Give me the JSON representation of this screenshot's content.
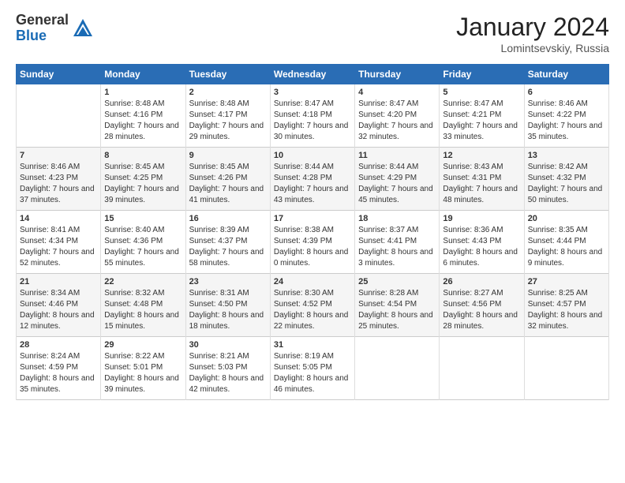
{
  "logo": {
    "general": "General",
    "blue": "Blue"
  },
  "title": "January 2024",
  "location": "Lomintsevskiy, Russia",
  "header_days": [
    "Sunday",
    "Monday",
    "Tuesday",
    "Wednesday",
    "Thursday",
    "Friday",
    "Saturday"
  ],
  "weeks": [
    [
      {
        "day": "",
        "sunrise": "",
        "sunset": "",
        "daylight": ""
      },
      {
        "day": "1",
        "sunrise": "Sunrise: 8:48 AM",
        "sunset": "Sunset: 4:16 PM",
        "daylight": "Daylight: 7 hours and 28 minutes."
      },
      {
        "day": "2",
        "sunrise": "Sunrise: 8:48 AM",
        "sunset": "Sunset: 4:17 PM",
        "daylight": "Daylight: 7 hours and 29 minutes."
      },
      {
        "day": "3",
        "sunrise": "Sunrise: 8:47 AM",
        "sunset": "Sunset: 4:18 PM",
        "daylight": "Daylight: 7 hours and 30 minutes."
      },
      {
        "day": "4",
        "sunrise": "Sunrise: 8:47 AM",
        "sunset": "Sunset: 4:20 PM",
        "daylight": "Daylight: 7 hours and 32 minutes."
      },
      {
        "day": "5",
        "sunrise": "Sunrise: 8:47 AM",
        "sunset": "Sunset: 4:21 PM",
        "daylight": "Daylight: 7 hours and 33 minutes."
      },
      {
        "day": "6",
        "sunrise": "Sunrise: 8:46 AM",
        "sunset": "Sunset: 4:22 PM",
        "daylight": "Daylight: 7 hours and 35 minutes."
      }
    ],
    [
      {
        "day": "7",
        "sunrise": "Sunrise: 8:46 AM",
        "sunset": "Sunset: 4:23 PM",
        "daylight": "Daylight: 7 hours and 37 minutes."
      },
      {
        "day": "8",
        "sunrise": "Sunrise: 8:45 AM",
        "sunset": "Sunset: 4:25 PM",
        "daylight": "Daylight: 7 hours and 39 minutes."
      },
      {
        "day": "9",
        "sunrise": "Sunrise: 8:45 AM",
        "sunset": "Sunset: 4:26 PM",
        "daylight": "Daylight: 7 hours and 41 minutes."
      },
      {
        "day": "10",
        "sunrise": "Sunrise: 8:44 AM",
        "sunset": "Sunset: 4:28 PM",
        "daylight": "Daylight: 7 hours and 43 minutes."
      },
      {
        "day": "11",
        "sunrise": "Sunrise: 8:44 AM",
        "sunset": "Sunset: 4:29 PM",
        "daylight": "Daylight: 7 hours and 45 minutes."
      },
      {
        "day": "12",
        "sunrise": "Sunrise: 8:43 AM",
        "sunset": "Sunset: 4:31 PM",
        "daylight": "Daylight: 7 hours and 48 minutes."
      },
      {
        "day": "13",
        "sunrise": "Sunrise: 8:42 AM",
        "sunset": "Sunset: 4:32 PM",
        "daylight": "Daylight: 7 hours and 50 minutes."
      }
    ],
    [
      {
        "day": "14",
        "sunrise": "Sunrise: 8:41 AM",
        "sunset": "Sunset: 4:34 PM",
        "daylight": "Daylight: 7 hours and 52 minutes."
      },
      {
        "day": "15",
        "sunrise": "Sunrise: 8:40 AM",
        "sunset": "Sunset: 4:36 PM",
        "daylight": "Daylight: 7 hours and 55 minutes."
      },
      {
        "day": "16",
        "sunrise": "Sunrise: 8:39 AM",
        "sunset": "Sunset: 4:37 PM",
        "daylight": "Daylight: 7 hours and 58 minutes."
      },
      {
        "day": "17",
        "sunrise": "Sunrise: 8:38 AM",
        "sunset": "Sunset: 4:39 PM",
        "daylight": "Daylight: 8 hours and 0 minutes."
      },
      {
        "day": "18",
        "sunrise": "Sunrise: 8:37 AM",
        "sunset": "Sunset: 4:41 PM",
        "daylight": "Daylight: 8 hours and 3 minutes."
      },
      {
        "day": "19",
        "sunrise": "Sunrise: 8:36 AM",
        "sunset": "Sunset: 4:43 PM",
        "daylight": "Daylight: 8 hours and 6 minutes."
      },
      {
        "day": "20",
        "sunrise": "Sunrise: 8:35 AM",
        "sunset": "Sunset: 4:44 PM",
        "daylight": "Daylight: 8 hours and 9 minutes."
      }
    ],
    [
      {
        "day": "21",
        "sunrise": "Sunrise: 8:34 AM",
        "sunset": "Sunset: 4:46 PM",
        "daylight": "Daylight: 8 hours and 12 minutes."
      },
      {
        "day": "22",
        "sunrise": "Sunrise: 8:32 AM",
        "sunset": "Sunset: 4:48 PM",
        "daylight": "Daylight: 8 hours and 15 minutes."
      },
      {
        "day": "23",
        "sunrise": "Sunrise: 8:31 AM",
        "sunset": "Sunset: 4:50 PM",
        "daylight": "Daylight: 8 hours and 18 minutes."
      },
      {
        "day": "24",
        "sunrise": "Sunrise: 8:30 AM",
        "sunset": "Sunset: 4:52 PM",
        "daylight": "Daylight: 8 hours and 22 minutes."
      },
      {
        "day": "25",
        "sunrise": "Sunrise: 8:28 AM",
        "sunset": "Sunset: 4:54 PM",
        "daylight": "Daylight: 8 hours and 25 minutes."
      },
      {
        "day": "26",
        "sunrise": "Sunrise: 8:27 AM",
        "sunset": "Sunset: 4:56 PM",
        "daylight": "Daylight: 8 hours and 28 minutes."
      },
      {
        "day": "27",
        "sunrise": "Sunrise: 8:25 AM",
        "sunset": "Sunset: 4:57 PM",
        "daylight": "Daylight: 8 hours and 32 minutes."
      }
    ],
    [
      {
        "day": "28",
        "sunrise": "Sunrise: 8:24 AM",
        "sunset": "Sunset: 4:59 PM",
        "daylight": "Daylight: 8 hours and 35 minutes."
      },
      {
        "day": "29",
        "sunrise": "Sunrise: 8:22 AM",
        "sunset": "Sunset: 5:01 PM",
        "daylight": "Daylight: 8 hours and 39 minutes."
      },
      {
        "day": "30",
        "sunrise": "Sunrise: 8:21 AM",
        "sunset": "Sunset: 5:03 PM",
        "daylight": "Daylight: 8 hours and 42 minutes."
      },
      {
        "day": "31",
        "sunrise": "Sunrise: 8:19 AM",
        "sunset": "Sunset: 5:05 PM",
        "daylight": "Daylight: 8 hours and 46 minutes."
      },
      {
        "day": "",
        "sunrise": "",
        "sunset": "",
        "daylight": ""
      },
      {
        "day": "",
        "sunrise": "",
        "sunset": "",
        "daylight": ""
      },
      {
        "day": "",
        "sunrise": "",
        "sunset": "",
        "daylight": ""
      }
    ]
  ]
}
